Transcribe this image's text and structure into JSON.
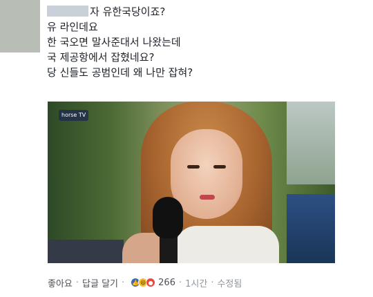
{
  "comment": {
    "lines": [
      "자 유한국당이죠?",
      "유 라인데요",
      "한 국오면 말사준대서 나왔는데",
      "국 제공항에서 잡혔네요?",
      "당 신들도 공범인데 왜 나만 잡혀?"
    ]
  },
  "video": {
    "logo_text": "horse TV"
  },
  "actions": {
    "like_label": "좋아요",
    "reply_label": "답글 달기",
    "reaction_count": "266",
    "time_label": "1시간",
    "edited_label": "수정됨",
    "reactions": [
      "like-icon",
      "haha-icon",
      "angry-icon"
    ]
  }
}
